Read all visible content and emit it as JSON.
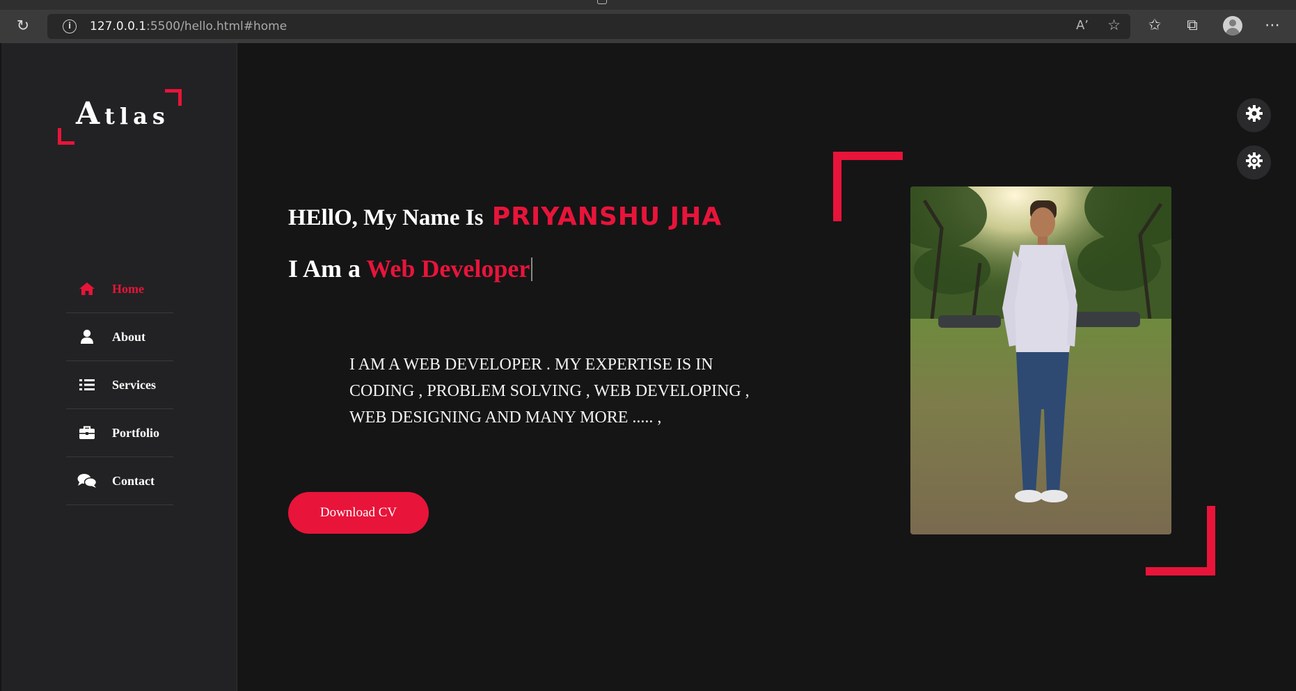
{
  "browser": {
    "url_host": "127.0.0.1",
    "url_rest": ":5500/hello.html#home",
    "icons": [
      "reload-icon",
      "site-info-icon",
      "read-aloud-icon",
      "add-favorite-icon",
      "favorites-icon",
      "collections-icon",
      "profile-avatar",
      "more-icon"
    ]
  },
  "logo": {
    "first": "A",
    "rest": "tlas"
  },
  "nav": {
    "items": [
      {
        "label": "Home",
        "icon": "home-icon",
        "active": true
      },
      {
        "label": "About",
        "icon": "user-icon",
        "active": false
      },
      {
        "label": "Services",
        "icon": "list-icon",
        "active": false
      },
      {
        "label": "Portfolio",
        "icon": "briefcase-icon",
        "active": false
      },
      {
        "label": "Contact",
        "icon": "chat-icon",
        "active": false
      }
    ]
  },
  "hero": {
    "greeting": "HEllO, My Name Is",
    "name": "PRIYANSHU JHA",
    "role_prefix": "I Am a",
    "role": "Web Developer",
    "description": "I AM A WEB DEVELOPER . MY EXPERTISE IS IN CODING , PROBLEM SOLVING , WEB DEVELOPING , WEB DESIGNING AND MANY MORE ..... ,",
    "button_label": "Download CV"
  },
  "settings": {
    "icons": [
      "settings-gear-icon",
      "theme-toggle-icon"
    ]
  },
  "colors": {
    "accent": "#e8143a",
    "background": "#151516",
    "sidebar": "#222224"
  }
}
